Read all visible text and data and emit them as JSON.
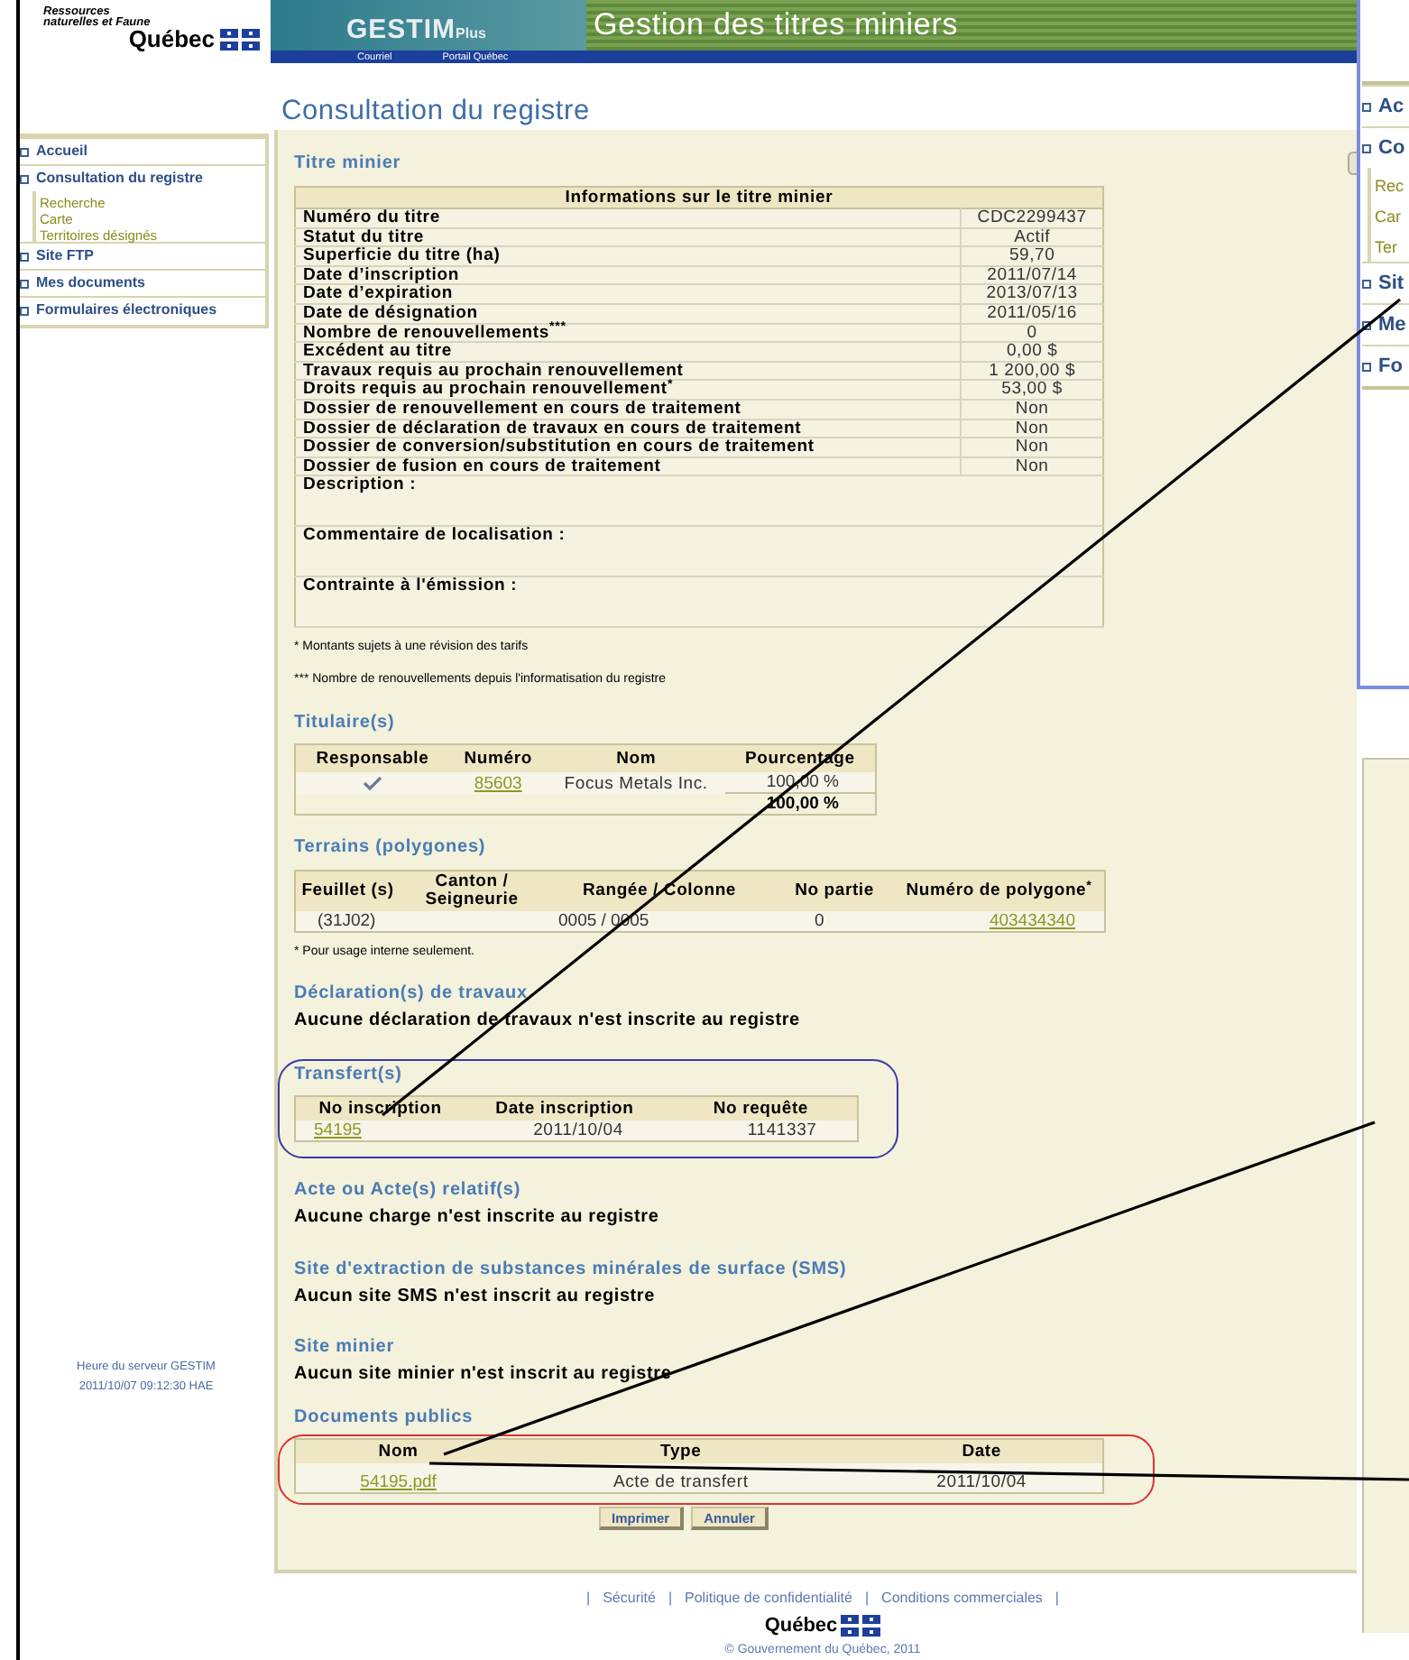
{
  "header": {
    "agency": "Ressources naturelles et Faune",
    "logo_text": "Québec",
    "brand": "GESTIM",
    "brand_suffix": "Plus",
    "app_title": "Gestion des titres miniers",
    "links": [
      "Courriel",
      "Portail Québec"
    ]
  },
  "page_title": "Consultation du registre",
  "sidebar": {
    "items": [
      {
        "label": "Accueil"
      },
      {
        "label": "Consultation du registre",
        "children": [
          {
            "label": "Recherche"
          },
          {
            "label": "Carte"
          },
          {
            "label": "Territoires désignés"
          }
        ]
      },
      {
        "label": "Site FTP"
      },
      {
        "label": "Mes documents"
      },
      {
        "label": "Formulaires électroniques"
      }
    ]
  },
  "server_time": {
    "label": "Heure du serveur GESTIM",
    "value": "2011/10/07 09:12:30 HAE"
  },
  "titre_minier": {
    "heading": "Titre minier",
    "table_title": "Informations sur le titre minier",
    "rows": [
      {
        "label": "Numéro du titre",
        "value": "CDC2299437"
      },
      {
        "label": "Statut du titre",
        "value": "Actif"
      },
      {
        "label": "Superficie du titre (ha)",
        "value": "59,70"
      },
      {
        "label": "Date d’inscription",
        "value": "2011/07/14"
      },
      {
        "label": "Date d’expiration",
        "value": "2013/07/13"
      },
      {
        "label": "Date de désignation",
        "value": "2011/05/16"
      },
      {
        "label": "Nombre de renouvellements$^{***}$",
        "value": "0"
      },
      {
        "label": "Excédent au titre",
        "value": "0,00 $"
      },
      {
        "label": "Travaux requis au prochain renouvellement",
        "value": "1 200,00 $"
      },
      {
        "label": "Droits requis au prochain renouvellement$^{*}$",
        "value": "53,00 $"
      },
      {
        "label": "Dossier de renouvellement en cours de traitement",
        "value": "Non"
      },
      {
        "label": "Dossier de déclaration de travaux en cours de traitement",
        "value": "Non"
      },
      {
        "label": "Dossier de conversion/substitution en cours de traitement",
        "value": "Non"
      },
      {
        "label": "Dossier de fusion en cours de traitement",
        "value": "Non"
      }
    ],
    "text_fields": [
      "Description :",
      "Commentaire de localisation :",
      "Contrainte à l'émission :"
    ],
    "footnotes": [
      "* Montants sujets à une révision des tarifs",
      "*** Nombre de renouvellements depuis l'informatisation du registre"
    ]
  },
  "titulaires": {
    "heading": "Titulaire(s)",
    "columns": [
      "Responsable",
      "Numéro",
      "Nom",
      "Pourcentage"
    ],
    "rows": [
      {
        "responsable": true,
        "numero": "85603",
        "nom": "Focus Metals Inc.",
        "pourcentage": "100,00 %"
      }
    ],
    "total": "100,00 %"
  },
  "terrains": {
    "heading": "Terrains (polygones)",
    "columns": [
      "Feuillet (s)",
      "Canton / Seigneurie",
      "Rangée / Colonne",
      "No partie",
      "Numéro de polygone$^{*}$"
    ],
    "rows": [
      [
        "(31J02)",
        "",
        "0005 / 0005",
        "0",
        "403434340"
      ]
    ],
    "note": "* Pour usage interne seulement."
  },
  "declarations": {
    "heading": "Déclaration(s) de travaux",
    "message": "Aucune déclaration de travaux n'est inscrite au registre"
  },
  "transferts": {
    "heading": "Transfert(s)",
    "color": "#3a3aa8",
    "columns": [
      "No inscription",
      "Date inscription",
      "No requête"
    ],
    "rows": [
      [
        "54195",
        "2011/10/04",
        "1141337"
      ]
    ]
  },
  "actes": {
    "heading": "Acte ou Acte(s) relatif(s)",
    "message": "Aucune charge n'est inscrite au registre"
  },
  "sms": {
    "heading": "Site d'extraction de substances minérales de surface (SMS)",
    "message": "Aucun site SMS n'est inscrit au registre"
  },
  "site_minier": {
    "heading": "Site minier",
    "message": "Aucun site minier n'est inscrit au registre"
  },
  "documents": {
    "heading": "Documents publics",
    "color": "#e03030",
    "columns": [
      "Nom",
      "Type",
      "Date"
    ],
    "rows": [
      [
        "54195.pdf",
        "Acte de transfert",
        "2011/10/04"
      ]
    ]
  },
  "buttons": [
    "Imprimer",
    "Annuler"
  ],
  "footer": {
    "separator": "|",
    "links": [
      "Sécurité",
      "Politique de confidentialité",
      "Conditions commerciales"
    ],
    "logo_text": "Québec",
    "copyright": "© Gouvernement du Québec, 2011"
  },
  "overlay_sidebar": {
    "items": [
      {
        "label": "Ac"
      },
      {
        "label": "Co",
        "children": [
          {
            "label": "Rec"
          },
          {
            "label": "Car"
          },
          {
            "label": "Ter"
          }
        ]
      },
      {
        "label": "Sit"
      },
      {
        "label": "Me"
      },
      {
        "label": "Fo"
      }
    ]
  }
}
